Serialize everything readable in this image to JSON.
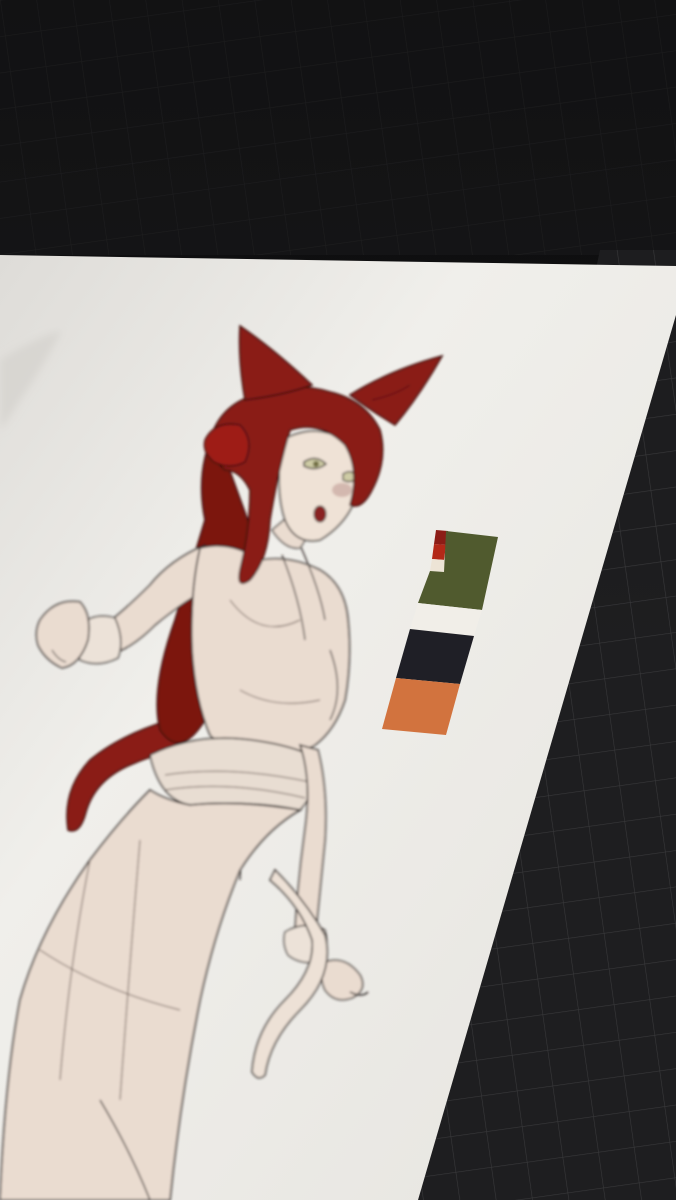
{
  "photo": {
    "subject": "drawing-tablet-canvas",
    "colors": {
      "background_dark": "#161618",
      "cutting_mat": "#1e1e20",
      "mat_grid": "#3a3a3c",
      "canvas": "#ecebe7",
      "skin": "#eadcd0",
      "line_art": "#2a2220",
      "hair": "#8a1a14",
      "hair_shadow": "#5e100c"
    }
  },
  "palette": {
    "swatches": [
      {
        "name": "hair-red",
        "color": "#8c1c16"
      },
      {
        "name": "bow-red",
        "color": "#b32818"
      },
      {
        "name": "cream",
        "color": "#ede4d6"
      },
      {
        "name": "olive-green",
        "color": "#505a2e"
      },
      {
        "name": "off-white",
        "color": "#f1eee8"
      },
      {
        "name": "charcoal",
        "color": "#1f1f26"
      },
      {
        "name": "burnt-orange",
        "color": "#d2733e"
      }
    ]
  }
}
